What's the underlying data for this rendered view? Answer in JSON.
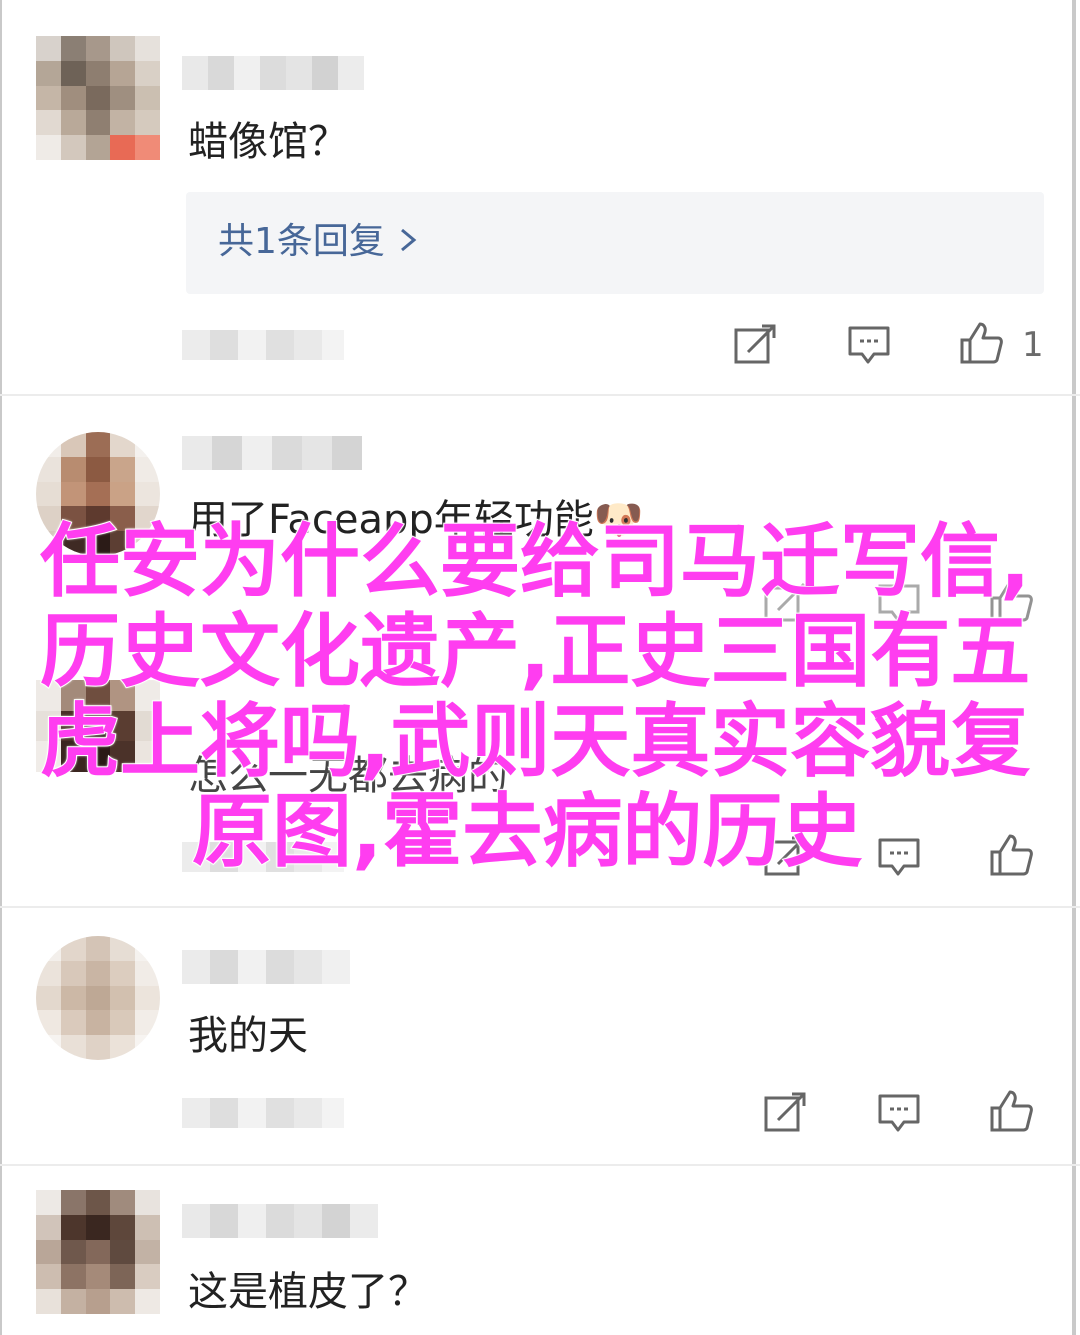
{
  "comments": [
    {
      "text": "蜡像馆？",
      "replies_label": "共1条回复",
      "like_count": "1"
    },
    {
      "text": "用了Faceapp年轻功能🐶",
      "second_line": "怎么一无都去病的",
      "like_count": ""
    },
    {
      "text": "我的天",
      "like_count": ""
    },
    {
      "text": "这是植皮了？"
    }
  ],
  "overlay": {
    "line1": "任安为什么要给司马迁写信,",
    "line2": "历史文化遗产,正史三国有五",
    "line3": "虎上将吗,武则天真实容貌复",
    "line4": "原图,霍去病的历史",
    "color": "#ff3df0"
  },
  "icons": {
    "share": "share-edit-icon",
    "comment": "comment-bubble-icon",
    "like": "thumbs-up-icon",
    "replies_arrow": "chevron-right-icon"
  }
}
